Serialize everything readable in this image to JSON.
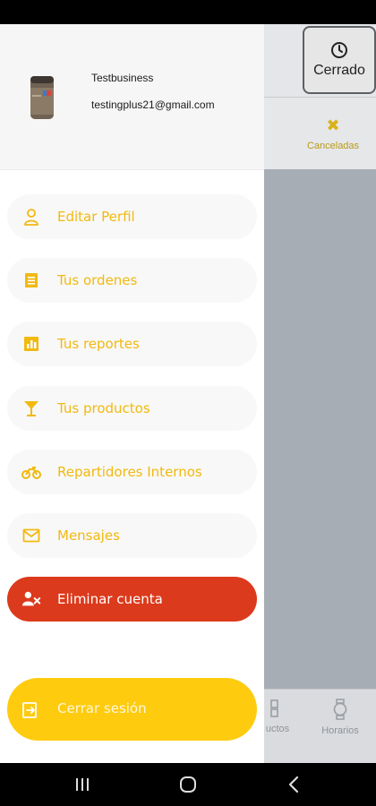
{
  "background_app": {
    "status_button_label": "Cerrado",
    "status_icon": "clock-icon",
    "cancel_tab_label": "Canceladas",
    "cancel_tab_icon": "x-icon",
    "bottom_nav": [
      {
        "label": "uctos",
        "icon": "grid-icon"
      },
      {
        "label": "Horarios",
        "icon": "watch-icon"
      }
    ]
  },
  "drawer": {
    "profile": {
      "name": "Testbusiness",
      "email": "testingplus21@gmail.com",
      "avatar_icon": "business-avatar-icon"
    },
    "menu": [
      {
        "label": "Editar Perfil",
        "icon": "user-outline-icon"
      },
      {
        "label": "Tus ordenes",
        "icon": "list-icon"
      },
      {
        "label": "Tus reportes",
        "icon": "bar-chart-icon"
      },
      {
        "label": "Tus productos",
        "icon": "cocktail-glass-icon"
      },
      {
        "label": "Repartidores Internos",
        "icon": "motorcycle-icon"
      },
      {
        "label": "Mensajes",
        "icon": "envelope-icon"
      }
    ],
    "delete_account_label": "Eliminar cuenta",
    "delete_account_icon": "user-remove-icon",
    "logout_label": "Cerrar sesión",
    "logout_icon": "sign-out-icon"
  },
  "colors": {
    "accent": "#f2b90f",
    "danger": "#dc3a1c",
    "logout": "#fecb0f"
  },
  "system_nav": [
    "recents-icon",
    "home-icon",
    "back-icon"
  ]
}
